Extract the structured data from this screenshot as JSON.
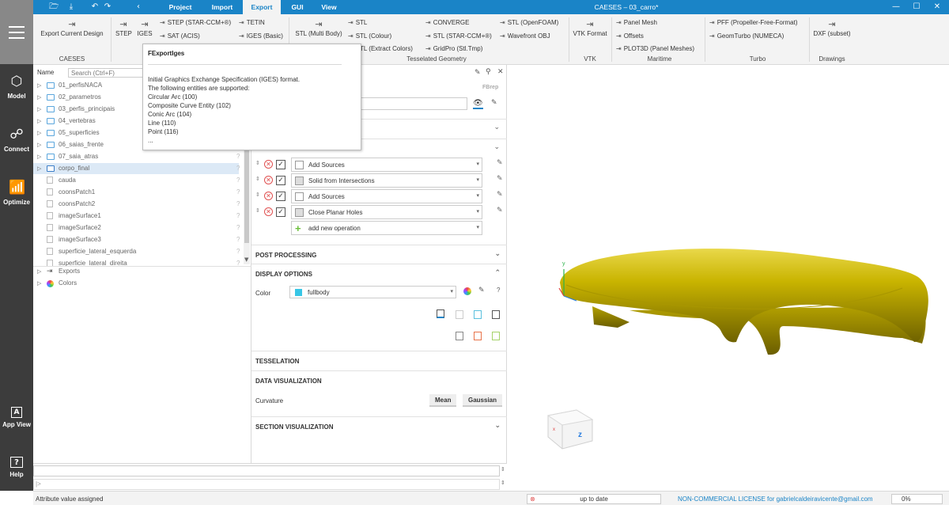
{
  "titlebar": {
    "window_title": "CAESES – 03_carro*",
    "menu_tabs": [
      "Project",
      "Import",
      "Export",
      "GUI",
      "View"
    ],
    "active_tab": "Export",
    "quick_icons": [
      "folder-open-icon",
      "save-icon",
      "undo-icon",
      "redo-icon"
    ],
    "window_controls": [
      "minimize",
      "maximize",
      "close"
    ]
  },
  "leftnav": {
    "items": [
      {
        "label": "Model",
        "icon": "cube-icon"
      },
      {
        "label": "Connect",
        "icon": "connect-icon"
      },
      {
        "label": "Optimize",
        "icon": "chart-icon"
      },
      {
        "label": "App View",
        "icon": "app-view-icon"
      },
      {
        "label": "Help",
        "icon": "help-icon"
      }
    ]
  },
  "ribbon": {
    "caeses": {
      "export_current_design": "Export Current Design",
      "label": "CAESES"
    },
    "cad": {
      "step": "STEP",
      "iges": "IGES",
      "step_ccm": "STEP (STAR-CCM+®)",
      "sat": "SAT (ACIS)",
      "tetin": "TETIN",
      "iges_basic": "IGES (Basic)"
    },
    "tess": {
      "stl_multi": "STL (Multi Body)",
      "stl": "STL",
      "stl_colour": "STL (Colour)",
      "stl_extract": "STL (Extract Colors)",
      "converge": "CONVERGE",
      "stl_ccm": "STL (STAR-CCM+®)",
      "gridpro": "GridPro (Stl.Tmp)",
      "stl_openfoam": "STL (OpenFOAM)",
      "wavefront": "Wavefront OBJ",
      "label": "Tesselated Geometry"
    },
    "vtk": {
      "vtk_format": "VTK Format",
      "label": "VTK"
    },
    "maritime": {
      "panel_mesh": "Panel Mesh",
      "offsets": "Offsets",
      "plot3d": "PLOT3D (Panel Meshes)",
      "label": "Maritime"
    },
    "turbo": {
      "pff": "PFF (Propeller-Free-Format)",
      "geomturbo": "GeomTurbo (NUMECA)",
      "label": "Turbo"
    },
    "drawings": {
      "dxf": "DXF (subset)",
      "label": "Drawings"
    }
  },
  "tooltip": {
    "title": "FExportIges",
    "lines": [
      "Initial Graphics Exchange Specification (IGES) format.",
      "The following entities are supported:",
      "Circular Arc (100)",
      "Composite Curve Entity (102)",
      "Conic Arc (104)",
      "Line (110)",
      "Point (116)",
      "..."
    ]
  },
  "tree": {
    "name_label": "Name",
    "search_placeholder": "Search (Ctrl+F)",
    "items": [
      {
        "label": "01_perfisNACA",
        "type": "folder"
      },
      {
        "label": "02_parametros",
        "type": "folder"
      },
      {
        "label": "03_perfis_principais",
        "type": "folder"
      },
      {
        "label": "04_vertebras",
        "type": "folder"
      },
      {
        "label": "05_superficies",
        "type": "folder"
      },
      {
        "label": "06_saias_frente",
        "type": "folder"
      },
      {
        "label": "07_saia_atras",
        "type": "folder"
      },
      {
        "label": "corpo_final",
        "type": "brep",
        "selected": true
      },
      {
        "label": "cauda",
        "type": "file"
      },
      {
        "label": "coonsPatch1",
        "type": "file"
      },
      {
        "label": "coonsPatch2",
        "type": "file"
      },
      {
        "label": "imageSurface1",
        "type": "file"
      },
      {
        "label": "imageSurface2",
        "type": "file"
      },
      {
        "label": "imageSurface3",
        "type": "file"
      },
      {
        "label": "superficie_lateral_esquerda",
        "type": "file"
      },
      {
        "label": "superficie_lateral_direita",
        "type": "file"
      }
    ],
    "bottom_items": [
      {
        "label": "Exports",
        "icon": "export-icon"
      },
      {
        "label": "Colors",
        "icon": "color-wheel-icon"
      }
    ]
  },
  "props": {
    "type_label": "FBrep",
    "operations": [
      {
        "label": "Add Sources"
      },
      {
        "label": "Solid from Intersections"
      },
      {
        "label": "Add Sources"
      },
      {
        "label": "Close Planar Holes"
      }
    ],
    "add_new_operation": "add new operation",
    "post_processing": "POST PROCESSING",
    "display_options": "DISPLAY OPTIONS",
    "color_label": "Color",
    "color_value": "fullbody",
    "color_swatch": "#38c6e6",
    "tesselation": "TESSELATION",
    "data_visualization": "DATA VISUALIZATION",
    "curvature_label": "Curvature",
    "mean": "Mean",
    "gaussian": "Gaussian",
    "section_visualization": "SECTION VISUALIZATION"
  },
  "viewport": {
    "axis_y": "y",
    "axis_z": "z",
    "body_color": "#c9b400"
  },
  "status": {
    "message": "Attribute value assigned",
    "up_to_date": "up to date",
    "license": "NON-COMMERCIAL LICENSE for gabrielcaldeiravicente@gmail.com",
    "progress": "0%"
  },
  "colors": {
    "accent": "#1a84c7",
    "nav_bg": "#3c3c3c"
  }
}
